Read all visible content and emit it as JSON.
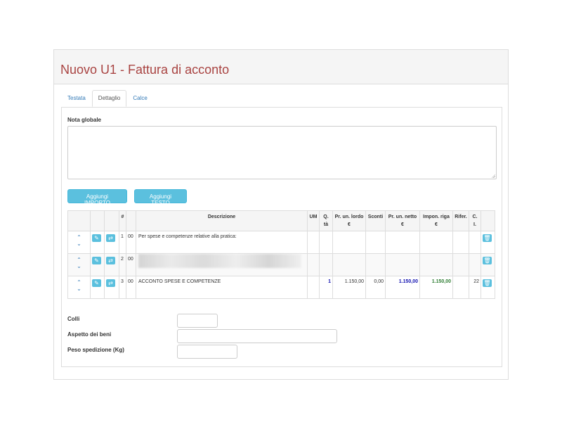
{
  "header": {
    "title": "Nuovo U1 - Fattura di acconto"
  },
  "tabs": [
    {
      "label": "Testata"
    },
    {
      "label": "Dettaglio"
    },
    {
      "label": "Calce"
    }
  ],
  "nota": {
    "label": "Nota globale",
    "value": ""
  },
  "buttons": {
    "add_importo": "Aggiungi IMPORTO",
    "add_testo": "Aggiungi TESTO"
  },
  "icons": {
    "up": "chevron-up-icon",
    "down": "chevron-down-icon",
    "edit": "edit-icon",
    "shuffle": "shuffle-icon",
    "delete": "trash-icon"
  },
  "table": {
    "headers": {
      "num": "#",
      "descrizione": "Descrizione",
      "um": "UM",
      "qta": "Q.\ntà",
      "pr_lordo": "Pr. un. lordo\n€",
      "sconti": "Sconti",
      "pr_netto": "Pr. un. netto\n€",
      "impon": "Impon. riga\n€",
      "rifer": "Rifer.",
      "ci": "C.\nI."
    },
    "rows": [
      {
        "num": "1",
        "code": "00",
        "descrizione": "Per spese e competenze relative alla pratica:",
        "um": "",
        "qta": "",
        "pr_lordo": "",
        "sconti": "",
        "pr_netto": "",
        "impon": "",
        "rifer": "",
        "ci": ""
      },
      {
        "num": "2",
        "code": "00",
        "descrizione": "",
        "um": "",
        "qta": "",
        "pr_lordo": "",
        "sconti": "",
        "pr_netto": "",
        "impon": "",
        "rifer": "",
        "ci": ""
      },
      {
        "num": "3",
        "code": "00",
        "descrizione": "ACCONTO SPESE E COMPETENZE",
        "um": "",
        "qta": "1",
        "pr_lordo": "1.150,00",
        "sconti": "0,00",
        "pr_netto": "1.150,00",
        "impon": "1.150,00",
        "rifer": "",
        "ci": "22"
      }
    ]
  },
  "form": {
    "colli": {
      "label": "Colli",
      "value": ""
    },
    "aspetto": {
      "label": "Aspetto dei beni",
      "value": ""
    },
    "peso": {
      "label": "Peso spedizione (Kg)",
      "value": ""
    }
  },
  "colors": {
    "title": "#a94442",
    "info": "#5bc0de",
    "link": "#337ab7",
    "net": "#1010b0",
    "impon": "#2e7d32"
  }
}
